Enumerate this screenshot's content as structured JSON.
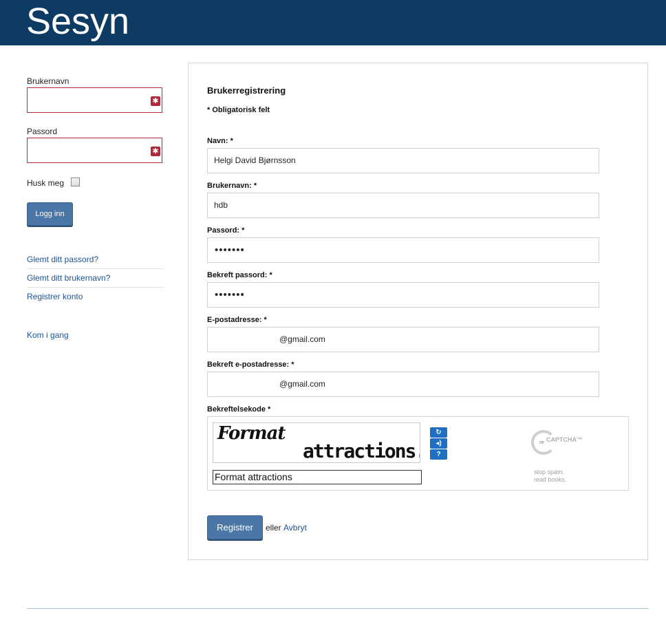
{
  "header": {
    "site_title": "Sesyn"
  },
  "sidebar": {
    "username_label": "Brukernavn",
    "password_label": "Passord",
    "remember_label": "Husk meg",
    "login_button": "Logg inn",
    "links": [
      "Glemt ditt passord?",
      "Glemt ditt brukernavn?",
      "Registrer konto"
    ],
    "getting_started": "Kom i gang"
  },
  "form": {
    "title": "Brukerregistrering",
    "required_note": "* Obligatorisk felt",
    "fields": [
      {
        "label": "Navn: *",
        "value": "Helgi David Bjørnsson"
      },
      {
        "label": "Brukernavn: *",
        "value": "hdb"
      },
      {
        "label": "Passord: *",
        "value": "•••••••"
      },
      {
        "label": "Bekreft passord: *",
        "value": "•••••••"
      },
      {
        "label": "E-postadresse: *",
        "value": "@gmail.com"
      },
      {
        "label": "Bekreft e-postadresse: *",
        "value": "@gmail.com"
      }
    ],
    "captcha": {
      "label": "Bekreftelsekode *",
      "word1": "Format",
      "word2": "attractions.",
      "response": "Format attractions",
      "brand": "CAPTCHA™",
      "brand_prefix": "re",
      "tagline_1": "stop spam.",
      "tagline_2": "read books."
    },
    "register_button": "Registrer",
    "or_text": "eller",
    "cancel_link": "Avbryt"
  },
  "colors": {
    "header_bg": "#0d3b63",
    "button_bg": "#4a76a8",
    "link": "#1f5291",
    "required_border": "#b0283a"
  }
}
